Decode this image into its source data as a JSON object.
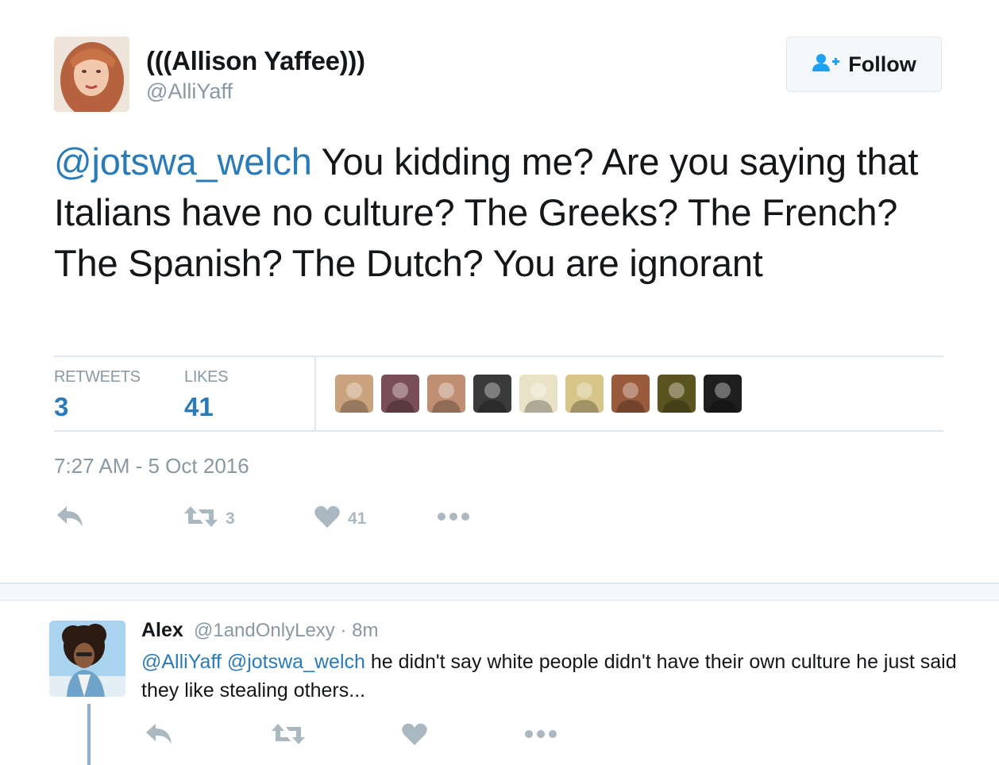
{
  "tweet": {
    "display_name": "(((Allison Yaffee)))",
    "handle": "@AlliYaff",
    "follow_label": "Follow",
    "text_mention": "@jotswa_welch",
    "text_body": "You kidding me? Are you saying that Italians have no culture? The Greeks? The French? The Spanish? The Dutch? You are ignorant",
    "stats": {
      "retweets_label": "RETWEETS",
      "retweets_value": "3",
      "likes_label": "LIKES",
      "likes_value": "41"
    },
    "timestamp": "7:27 AM - 5 Oct 2016",
    "actions": {
      "reply_icon": "reply-icon",
      "retweet_icon": "retweet-icon",
      "retweet_count": "3",
      "like_icon": "heart-icon",
      "like_count": "41",
      "more_icon": "more-icon"
    }
  },
  "likers": [
    {
      "name": "liker-avatar-1",
      "color": "#c9a27e"
    },
    {
      "name": "liker-avatar-2",
      "color": "#7a4d5a"
    },
    {
      "name": "liker-avatar-3",
      "color": "#c08f73"
    },
    {
      "name": "liker-avatar-4",
      "color": "#3a3a3a"
    },
    {
      "name": "liker-avatar-5",
      "color": "#e9e2c7"
    },
    {
      "name": "liker-avatar-6",
      "color": "#d8c58a"
    },
    {
      "name": "liker-avatar-7",
      "color": "#9a5a3c"
    },
    {
      "name": "liker-avatar-8",
      "color": "#5c5420"
    },
    {
      "name": "liker-avatar-9",
      "color": "#1e1e1e"
    }
  ],
  "reply": {
    "display_name": "Alex",
    "handle": "@1andOnlyLexy",
    "time": "· 8m",
    "mention_1": "@AlliYaff",
    "mention_2": "@jotswa_welch",
    "text": "he didn't say white people didn't have their own culture he just said they like stealing others..."
  },
  "colors": {
    "link": "#2b7bb9",
    "muted": "#8899a6",
    "action": "#aab8c2",
    "follow_icon": "#1da1f2",
    "thread_line": "#8fb0d6"
  }
}
